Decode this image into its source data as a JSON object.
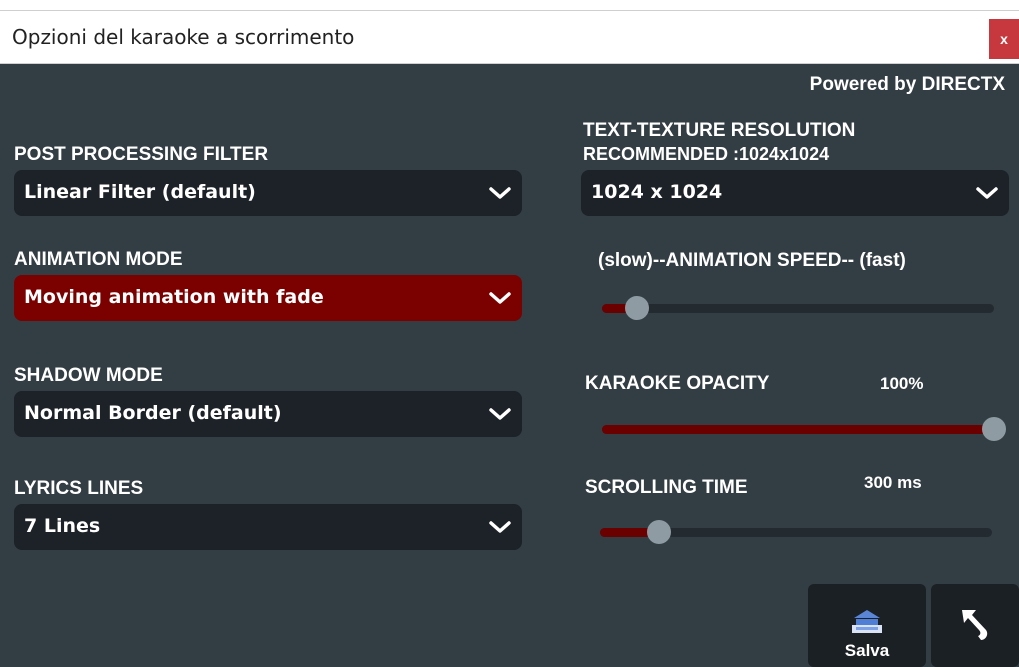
{
  "window": {
    "title": "Opzioni del karaoke a scorrimento",
    "close_label": "x"
  },
  "powered_by": "Powered by DIRECTX",
  "left": {
    "post_processing": {
      "label": "POST PROCESSING FILTER",
      "value": "Linear Filter (default)"
    },
    "animation_mode": {
      "label": "ANIMATION MODE",
      "value": "Moving animation with fade",
      "color": "#7b0000"
    },
    "shadow_mode": {
      "label": "SHADOW MODE",
      "value": "Normal Border (default)"
    },
    "lyrics_lines": {
      "label": "LYRICS LINES",
      "value": "7 Lines"
    }
  },
  "right": {
    "texture": {
      "label_line1": "TEXT-TEXTURE RESOLUTION",
      "label_line2": "RECOMMENDED :1024x1024",
      "value": "1024 x 1024"
    },
    "animation_speed": {
      "label": "(slow)--ANIMATION SPEED-- (fast)",
      "level": 0.09
    },
    "opacity": {
      "label": "KARAOKE OPACITY",
      "value_text": "100%",
      "level": 1.0
    },
    "scrolling_time": {
      "label": "SCROLLING TIME",
      "value_text": "300 ms",
      "level": 0.15
    }
  },
  "buttons": {
    "save_label": "Salva",
    "save_icon": "save-icon",
    "back_icon": "back-arrow-icon"
  },
  "colors": {
    "accent_red": "#7b0000",
    "panel": "#333d44",
    "control": "#1c2227",
    "slider_fill": "#6a0000"
  }
}
